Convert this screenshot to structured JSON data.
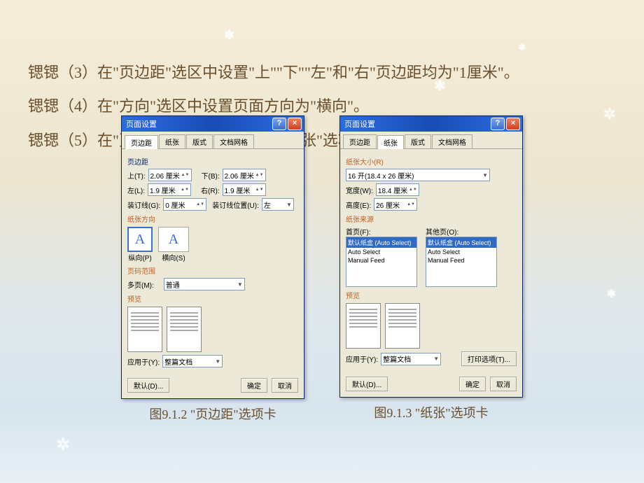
{
  "text": {
    "p1": "锶锶（3）在\"页边距\"选区中设置\"上\"\"下\"\"左\"和\"右\"页边距均为\"1厘米\"。",
    "p2": "锶锶（4）在\"方向\"选区中设置页面方向为\"横向\"。",
    "p3": "锶锶（5）在\"页面设置\"对话框中打开\"纸张\"选项卡，如图9.1.3所示。"
  },
  "dialog": {
    "title": "页面设置",
    "tabs": {
      "margins": "页边距",
      "paper": "纸张",
      "layout": "版式",
      "docgrid": "文档网格"
    },
    "groups": {
      "margins": "页边距",
      "orientation": "纸张方向",
      "pages": "页码范围",
      "preview": "预览",
      "papersize": "纸张大小(R)",
      "papersource": "纸张来源"
    },
    "margins": {
      "top_label": "上(T):",
      "top_val": "2.06 厘米",
      "bottom_label": "下(B):",
      "bottom_val": "2.06 厘米",
      "left_label": "左(L):",
      "left_val": "1.9 厘米",
      "right_label": "右(R):",
      "right_val": "1.9 厘米",
      "gutter_label": "装订线(G):",
      "gutter_val": "0 厘米",
      "gutterpos_label": "装订线位置(U):",
      "gutterpos_val": "左"
    },
    "orientation": {
      "portrait": "纵向(P)",
      "landscape": "横向(S)"
    },
    "pages": {
      "multi_label": "多页(M):",
      "multi_val": "普通"
    },
    "apply": {
      "label": "应用于(Y):",
      "val": "整篇文档"
    },
    "paper": {
      "size_val": "16 开(18.4 x 26 厘米)",
      "width_label": "宽度(W):",
      "width_val": "18.4 厘米",
      "height_label": "高度(E):",
      "height_val": "26 厘米",
      "first_label": "首页(F):",
      "other_label": "其他页(O):",
      "tray_default": "默认纸盒 (Auto Select)",
      "tray_auto": "Auto Select",
      "tray_manual": "Manual Feed"
    },
    "buttons": {
      "default": "默认(D)...",
      "ok": "确定",
      "cancel": "取消",
      "printoptions": "打印选项(T)..."
    }
  },
  "captions": {
    "fig912": "图9.1.2  \"页边距\"选项卡",
    "fig913": "图9.1.3  \"纸张\"选项卡"
  }
}
